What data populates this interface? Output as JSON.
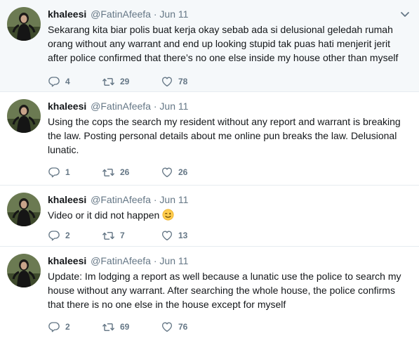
{
  "tweets": [
    {
      "name": "khaleesi",
      "handle": "@FatinAfeefa",
      "sep": "·",
      "date": "Jun 11",
      "text": "Sekarang kita biar polis buat kerja okay sebab ada si delusional  geledah rumah\norang without any warrant and end up looking stupid tak puas hati menjerit jerit\nafter police confirmed that there’s no one else inside my house other than myself",
      "replies": "4",
      "retweets": "29",
      "likes": "78"
    },
    {
      "name": "khaleesi",
      "handle": "@FatinAfeefa",
      "sep": "·",
      "date": "Jun 11",
      "text": "Using the cops the search my resident without any report and warrant is breaking\nthe law. Posting personal details about me online pun breaks the law. Delusional\nlunatic.",
      "replies": "1",
      "retweets": "26",
      "likes": "26"
    },
    {
      "name": "khaleesi",
      "handle": "@FatinAfeefa",
      "sep": "·",
      "date": "Jun 11",
      "text": "Video or it did not happen",
      "emoji": "winking-face-icon",
      "replies": "2",
      "retweets": "7",
      "likes": "13"
    },
    {
      "name": "khaleesi",
      "handle": "@FatinAfeefa",
      "sep": "·",
      "date": "Jun 11",
      "text": "Update: Im lodging a report as well because a lunatic use the police to search my\nhouse without any warrant. After searching the whole house, the police confirms\nthat there is no one else in the house except for myself",
      "replies": "2",
      "retweets": "69",
      "likes": "76"
    }
  ],
  "icons": {
    "reply": "reply-icon",
    "retweet": "retweet-icon",
    "like": "heart-icon",
    "caret": "chevron-down-icon"
  },
  "colors": {
    "text": "#14171a",
    "secondary": "#657786",
    "divider": "#e6ecf0",
    "highlight_bg": "#f5f8fa"
  }
}
